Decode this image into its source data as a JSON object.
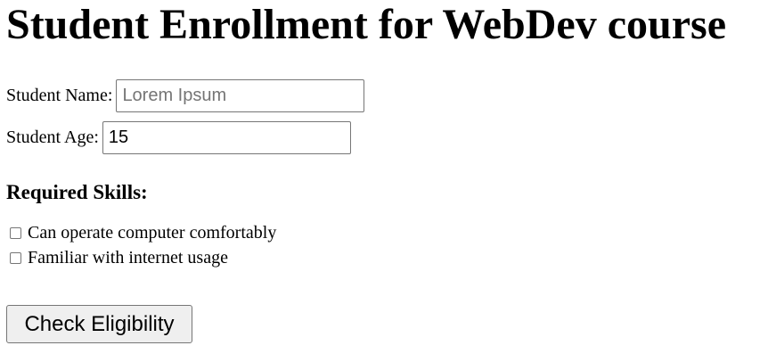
{
  "page": {
    "title": "Student Enrollment for WebDev course"
  },
  "form": {
    "name": {
      "label": "Student Name:",
      "value": "",
      "placeholder": "Lorem Ipsum"
    },
    "age": {
      "label": "Student Age:",
      "value": "15",
      "placeholder": ""
    }
  },
  "skills": {
    "heading": "Required Skills:",
    "items": [
      {
        "label": "Can operate computer comfortably",
        "checked": false
      },
      {
        "label": "Familiar with internet usage",
        "checked": false
      }
    ]
  },
  "actions": {
    "submit_label": "Check Eligibility"
  }
}
